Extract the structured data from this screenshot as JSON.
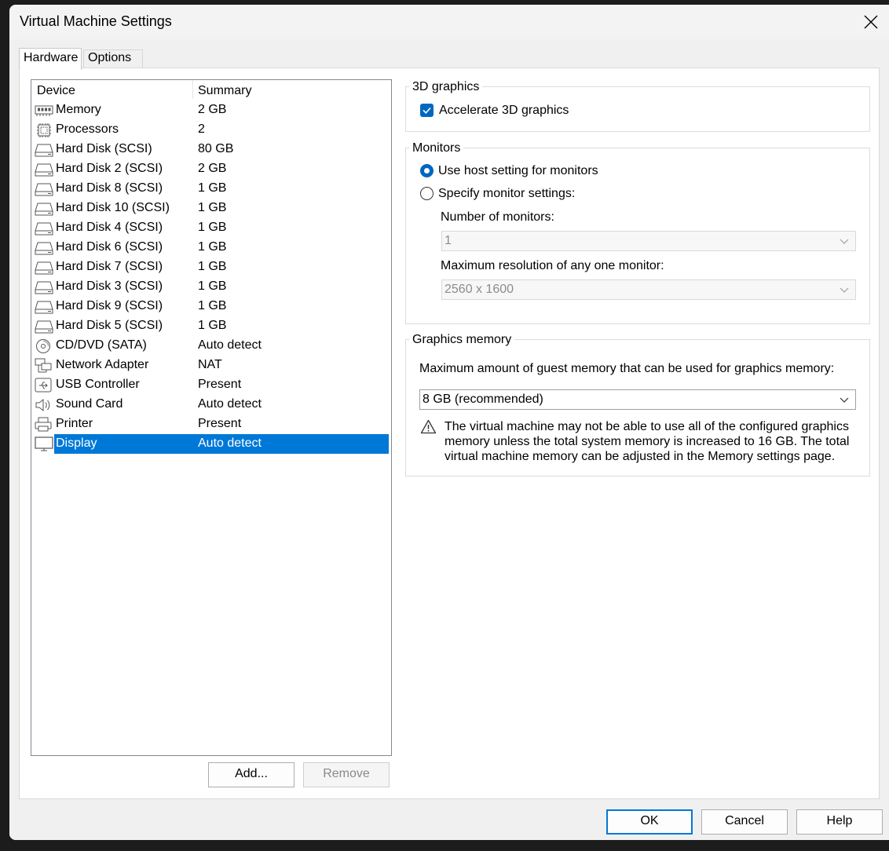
{
  "window": {
    "title": "Virtual Machine Settings"
  },
  "tabs": [
    {
      "label": "Hardware"
    },
    {
      "label": "Options"
    }
  ],
  "device_list": {
    "headers": {
      "device": "Device",
      "summary": "Summary"
    },
    "rows": [
      {
        "icon": "memory-icon",
        "name": "Memory",
        "summary": "2 GB"
      },
      {
        "icon": "processor-icon",
        "name": "Processors",
        "summary": "2"
      },
      {
        "icon": "hard-disk-icon",
        "name": "Hard Disk (SCSI)",
        "summary": "80 GB"
      },
      {
        "icon": "hard-disk-icon",
        "name": "Hard Disk 2 (SCSI)",
        "summary": "2 GB"
      },
      {
        "icon": "hard-disk-icon",
        "name": "Hard Disk 8 (SCSI)",
        "summary": "1 GB"
      },
      {
        "icon": "hard-disk-icon",
        "name": "Hard Disk 10 (SCSI)",
        "summary": "1 GB"
      },
      {
        "icon": "hard-disk-icon",
        "name": "Hard Disk 4 (SCSI)",
        "summary": "1 GB"
      },
      {
        "icon": "hard-disk-icon",
        "name": "Hard Disk 6 (SCSI)",
        "summary": "1 GB"
      },
      {
        "icon": "hard-disk-icon",
        "name": "Hard Disk 7 (SCSI)",
        "summary": "1 GB"
      },
      {
        "icon": "hard-disk-icon",
        "name": "Hard Disk 3 (SCSI)",
        "summary": "1 GB"
      },
      {
        "icon": "hard-disk-icon",
        "name": "Hard Disk 9 (SCSI)",
        "summary": "1 GB"
      },
      {
        "icon": "hard-disk-icon",
        "name": "Hard Disk 5 (SCSI)",
        "summary": "1 GB"
      },
      {
        "icon": "cd-dvd-icon",
        "name": "CD/DVD (SATA)",
        "summary": "Auto detect"
      },
      {
        "icon": "network-adapter-icon",
        "name": "Network Adapter",
        "summary": "NAT"
      },
      {
        "icon": "usb-icon",
        "name": "USB Controller",
        "summary": "Present"
      },
      {
        "icon": "speaker-icon",
        "name": "Sound Card",
        "summary": "Auto detect"
      },
      {
        "icon": "printer-icon",
        "name": "Printer",
        "summary": "Present"
      },
      {
        "icon": "display-icon",
        "name": "Display",
        "summary": "Auto detect",
        "selected": true
      }
    ],
    "add_label": "Add...",
    "remove_label": "Remove"
  },
  "graphics3d": {
    "group_label": "3D graphics",
    "accelerate_label": "Accelerate 3D graphics",
    "accelerate_checked": true
  },
  "monitors": {
    "group_label": "Monitors",
    "use_host_label": "Use host setting for monitors",
    "use_host_selected": true,
    "specify_label": "Specify monitor settings:",
    "specify_selected": false,
    "number_label": "Number of monitors:",
    "number_value": "1",
    "resolution_label": "Maximum resolution of any one monitor:",
    "resolution_value": "2560 x 1600"
  },
  "graphics_memory": {
    "group_label": "Graphics memory",
    "description": "Maximum amount of guest memory that can be used for graphics memory:",
    "value": "8 GB (recommended)",
    "warning": "The virtual machine may not be able to use all of the configured graphics memory unless the total system memory is increased to 16 GB. The total virtual machine memory can be adjusted in the Memory settings page."
  },
  "footer": {
    "ok_label": "OK",
    "cancel_label": "Cancel",
    "help_label": "Help"
  },
  "colors": {
    "accent": "#0078d7",
    "checkbox": "#0067c0"
  }
}
